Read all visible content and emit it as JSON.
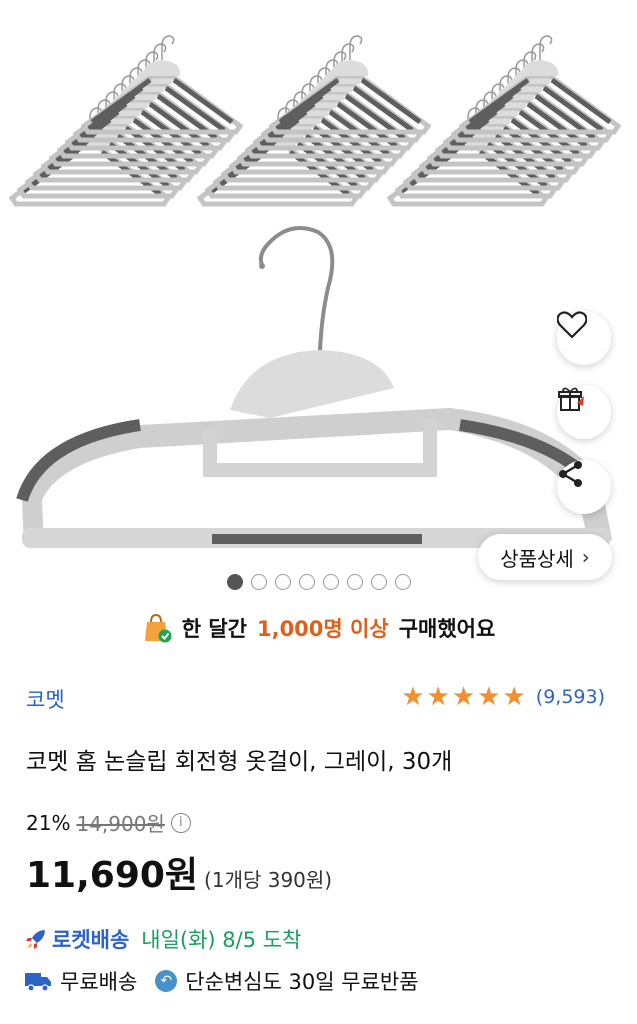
{
  "gallery": {
    "detail_button_label": "상품상세",
    "detail_chevron": "›",
    "dot_count": 8,
    "active_dot_index": 0
  },
  "actions": {
    "like_icon": "heart-icon",
    "gift_icon": "gift-icon",
    "share_icon": "share-icon"
  },
  "social_proof": {
    "prefix": "한 달간",
    "highlight": "1,000명 이상",
    "suffix": "구매했어요",
    "highlight_color": "#e0601a"
  },
  "product": {
    "brand": "코멧",
    "rating_stars": 5,
    "review_count": "(9,593)",
    "title": "코멧 홈 논슬립 회전형 옷걸이, 그레이, 30개",
    "discount_rate": "21%",
    "original_price": "14,900원",
    "price": "11,690원",
    "unit_price": "(1개당 390원)"
  },
  "delivery": {
    "rocket_label": "로켓배송",
    "arrival_text": "내일(화) 8/5 도착",
    "free_shipping": "무료배송",
    "free_return": "단순변심도 30일 무료반품"
  },
  "colors": {
    "brand_blue": "#2c63c7",
    "star_orange": "#f28f2e",
    "arrival_green": "#17a05d"
  }
}
